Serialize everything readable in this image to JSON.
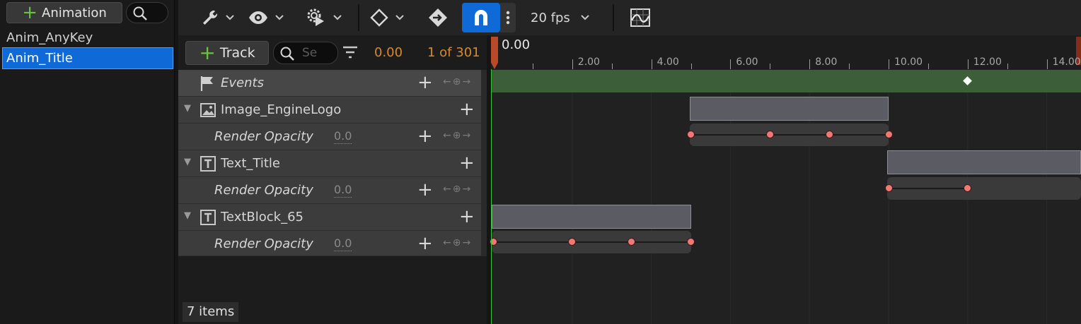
{
  "animations": {
    "add_label": "Animation",
    "items": [
      {
        "label": "Anim_AnyKey",
        "selected": false
      },
      {
        "label": "Anim_Title",
        "selected": true
      }
    ]
  },
  "toolbar": {
    "fps_label": "20 fps",
    "magnet_active": true,
    "accent_color": "#0f6ad8"
  },
  "tracks_header": {
    "add_label": "Track",
    "search_placeholder": "Se",
    "current_time": "0.00",
    "frame_counter": "1 of 301",
    "accent_color": "#d88a2a"
  },
  "tracks": [
    {
      "label": "Events",
      "kind": "events"
    },
    {
      "label": "Image_EngineLogo",
      "kind": "image"
    },
    {
      "label": "Render Opacity",
      "value": "0.0",
      "kind": "property"
    },
    {
      "label": "Text_Title",
      "kind": "text"
    },
    {
      "label": "Render Opacity",
      "value": "0.0",
      "kind": "property"
    },
    {
      "label": "TextBlock_65",
      "kind": "text"
    },
    {
      "label": "Render Opacity",
      "value": "0.0",
      "kind": "property"
    }
  ],
  "status": {
    "item_count": "7 items"
  },
  "timeline": {
    "playhead_label": "0.00",
    "ruler_labels": [
      "2.00",
      "4.00",
      "6.00",
      "8.00",
      "10.00",
      "12.00",
      "14.00"
    ],
    "event_key_time": 12.0,
    "clips": [
      {
        "track": "Image_EngineLogo",
        "start": 5.0,
        "end": 10.0,
        "keys": [
          5.0,
          7.0,
          8.5,
          10.0
        ]
      },
      {
        "track": "Text_Title",
        "start": 10.0,
        "end": 15.0,
        "keys": [
          10.0,
          12.0
        ]
      },
      {
        "track": "TextBlock_65",
        "start": 0.0,
        "end": 5.0,
        "keys": [
          0.0,
          2.0,
          3.5,
          5.0
        ]
      }
    ]
  }
}
